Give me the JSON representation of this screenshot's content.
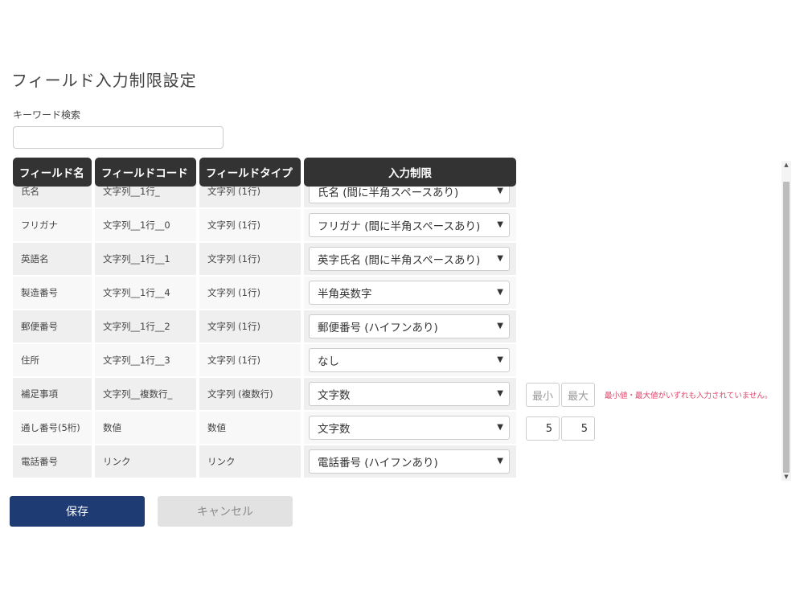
{
  "page": {
    "title": "フィールド入力制限設定",
    "keyword_label": "キーワード検索",
    "keyword_value": ""
  },
  "table": {
    "headers": [
      "フィールド名",
      "フィールドコード",
      "フィールドタイプ",
      "入力制限"
    ],
    "rows": [
      {
        "name": "氏名",
        "code": "文字列__1行_",
        "type": "文字列 (1行)",
        "restriction": "氏名 (間に半角スペースあり)"
      },
      {
        "name": "フリガナ",
        "code": "文字列__1行__0",
        "type": "文字列 (1行)",
        "restriction": "フリガナ (間に半角スペースあり)"
      },
      {
        "name": "英語名",
        "code": "文字列__1行__1",
        "type": "文字列 (1行)",
        "restriction": "英字氏名 (間に半角スペースあり)"
      },
      {
        "name": "製造番号",
        "code": "文字列__1行__4",
        "type": "文字列 (1行)",
        "restriction": "半角英数字"
      },
      {
        "name": "郵便番号",
        "code": "文字列__1行__2",
        "type": "文字列 (1行)",
        "restriction": "郵便番号 (ハイフンあり)"
      },
      {
        "name": "住所",
        "code": "文字列__1行__3",
        "type": "文字列 (1行)",
        "restriction": "なし"
      },
      {
        "name": "補足事項",
        "code": "文字列__複数行_",
        "type": "文字列 (複数行)",
        "restriction": "文字数"
      },
      {
        "name": "通し番号(5桁)",
        "code": "数値",
        "type": "数値",
        "restriction": "文字数"
      },
      {
        "name": "電話番号",
        "code": "リンク",
        "type": "リンク",
        "restriction": "電話番号 (ハイフンあり)"
      }
    ],
    "row6_min_placeholder": "最小",
    "row6_max_placeholder": "最大",
    "row6_error": "最小値・最大値がいずれも入力されていません。",
    "row7_min_value": "5",
    "row7_max_value": "5"
  },
  "buttons": {
    "save": "保存",
    "cancel": "キャンセル"
  },
  "icons": {
    "chevron": "chevron-down-icon",
    "scroll_up": "scroll-up-arrow-icon",
    "scroll_down": "scroll-down-arrow-icon"
  },
  "colors": {
    "header_bg": "#333333",
    "save_bg": "#1e3b73",
    "error_text": "#e0466b"
  }
}
